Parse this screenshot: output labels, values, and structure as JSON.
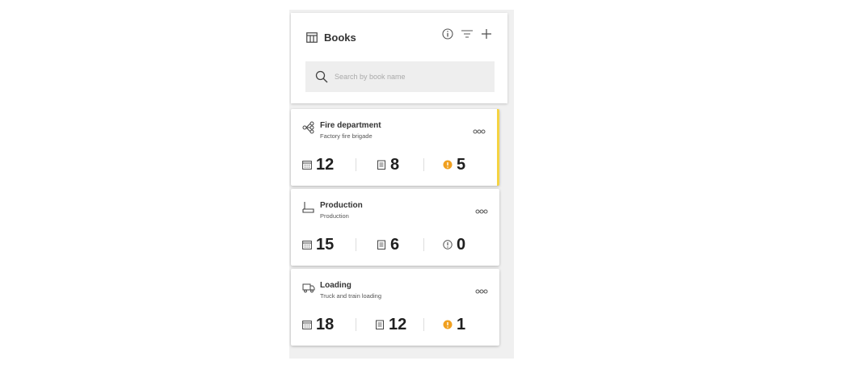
{
  "header": {
    "title": "Books",
    "icons": [
      "table-icon",
      "info-icon",
      "filter-icon",
      "add-icon"
    ]
  },
  "search": {
    "placeholder": "Search by book name"
  },
  "books": [
    {
      "title": "Fire department",
      "subtitle": "Factory fire brigade",
      "icon": "hierarchy-icon",
      "active": true,
      "stats": {
        "calendar": "12",
        "clipboard": "8",
        "alerts": "5"
      },
      "alert_state": "warning"
    },
    {
      "title": "Production",
      "subtitle": "Production",
      "icon": "machine-icon",
      "active": false,
      "stats": {
        "calendar": "15",
        "clipboard": "6",
        "alerts": "0"
      },
      "alert_state": "none"
    },
    {
      "title": "Loading",
      "subtitle": "Truck and train loading",
      "icon": "truck-icon",
      "active": false,
      "stats": {
        "calendar": "18",
        "clipboard": "12",
        "alerts": "1"
      },
      "alert_state": "warning"
    }
  ],
  "colors": {
    "accent": "#f5d342",
    "warning": "#f0a020",
    "panel_bg": "#f0f0f0",
    "text": "#1f1f1f"
  }
}
